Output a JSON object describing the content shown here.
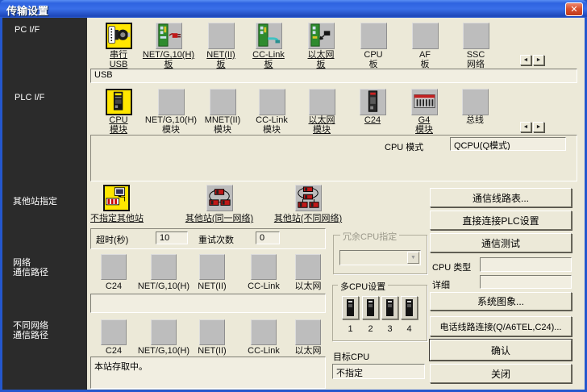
{
  "window": {
    "title": "传输设置",
    "close_glyph": "✕"
  },
  "glyphs": {
    "left": "◄",
    "right": "►",
    "down": "▼"
  },
  "colors": {
    "titlebar": "#2e63d8",
    "selected": "#ffe600",
    "sidebar_bg": "#2b2b2b",
    "dialog_bg": "#ece9d8"
  },
  "sidebar": {
    "pc_if": "PC I/F",
    "plc_if": "PLC I/F",
    "other_station": "其他站指定",
    "network_line1": "网络",
    "network_line2": "通信路径",
    "diff_network_line1": "不同网络",
    "diff_network_line2": "通信路径"
  },
  "pc_if": {
    "value": "USB",
    "items": [
      {
        "l1": "串行",
        "l2": "USB"
      },
      {
        "l1": "NET/G,10(H)",
        "l2": "板"
      },
      {
        "l1": "NET(II)",
        "l2": "板"
      },
      {
        "l1": "CC-Link",
        "l2": "板"
      },
      {
        "l1": "以太网",
        "l2": "板"
      },
      {
        "l1": "CPU",
        "l2": "板"
      },
      {
        "l1": "AF",
        "l2": "板"
      },
      {
        "l1": "SSC",
        "l2": "网络"
      }
    ]
  },
  "plc_if": {
    "cpu_mode_label": "CPU 模式",
    "cpu_mode_value": "QCPU(Q模式)",
    "items": [
      {
        "l1": "CPU",
        "l2": "模块"
      },
      {
        "l1": "NET/G,10(H)",
        "l2": "模块"
      },
      {
        "l1": "MNET(II)",
        "l2": "模块"
      },
      {
        "l1": "CC-Link",
        "l2": "模块"
      },
      {
        "l1": "以太网",
        "l2": "模块"
      },
      {
        "l1": "C24",
        "l2": ""
      },
      {
        "l1": "G4",
        "l2": "模块"
      },
      {
        "l1": "总线",
        "l2": ""
      }
    ]
  },
  "other_station": {
    "no_other": "不指定其他站",
    "same_net": "其他站(同一网络)",
    "diff_net": "其他站(不同网络)",
    "timeout_label": "超时(秒)",
    "timeout_value": "10",
    "retry_label": "重试次数",
    "retry_value": "0"
  },
  "network_route": {
    "labels": [
      "C24",
      "NET/G,10(H)",
      "NET(II)",
      "CC-Link",
      "以太网"
    ],
    "value": ""
  },
  "diff_network_route": {
    "labels": [
      "C24",
      "NET/G,10(H)",
      "NET(II)",
      "CC-Link",
      "以太网"
    ],
    "status": "本站存取中。"
  },
  "redundant_cpu": {
    "title": "冗余CPU指定",
    "value": ""
  },
  "multi_cpu": {
    "title": "多CPU设置",
    "labels": [
      "1",
      "2",
      "3",
      "4"
    ]
  },
  "target_cpu": {
    "label": "目标CPU",
    "value": "不指定"
  },
  "actions": {
    "line_list": "通信线路表...",
    "direct_plc": "直接连接PLC设置",
    "comm_test": "通信测试",
    "cpu_type_label": "CPU 类型",
    "cpu_type_value": "",
    "detail_label": "详细",
    "detail_value": "",
    "system_image": "系统图象...",
    "phone_line": "电话线路连接(Q/A6TEL,C24)...",
    "ok": "确认",
    "close": "关闭"
  }
}
